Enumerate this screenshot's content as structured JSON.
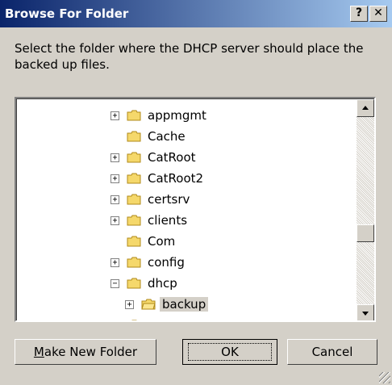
{
  "window": {
    "title": "Browse For Folder",
    "help_glyph": "?",
    "close_glyph": "✕"
  },
  "instruction": "Select the folder where the DHCP server should place the backed up files.",
  "tree": {
    "items": [
      {
        "label": "appmgmt",
        "expander": "+"
      },
      {
        "label": "Cache",
        "expander": ""
      },
      {
        "label": "CatRoot",
        "expander": "+"
      },
      {
        "label": "CatRoot2",
        "expander": "+"
      },
      {
        "label": "certsrv",
        "expander": "+"
      },
      {
        "label": "clients",
        "expander": "+"
      },
      {
        "label": "Com",
        "expander": ""
      },
      {
        "label": "config",
        "expander": "+"
      },
      {
        "label": "dhcp",
        "expander": "−"
      },
      {
        "label": "backup",
        "expander": "+",
        "selected": true
      }
    ]
  },
  "buttons": {
    "make_new_folder_mnemonic": "M",
    "make_new_folder_rest": "ake New Folder",
    "ok": "OK",
    "cancel": "Cancel"
  },
  "colors": {
    "titlebar_start": "#0a246a",
    "titlebar_end": "#a6caf0",
    "dialog_face": "#d4d0c8",
    "folder_yellow": "#f5d86b"
  }
}
